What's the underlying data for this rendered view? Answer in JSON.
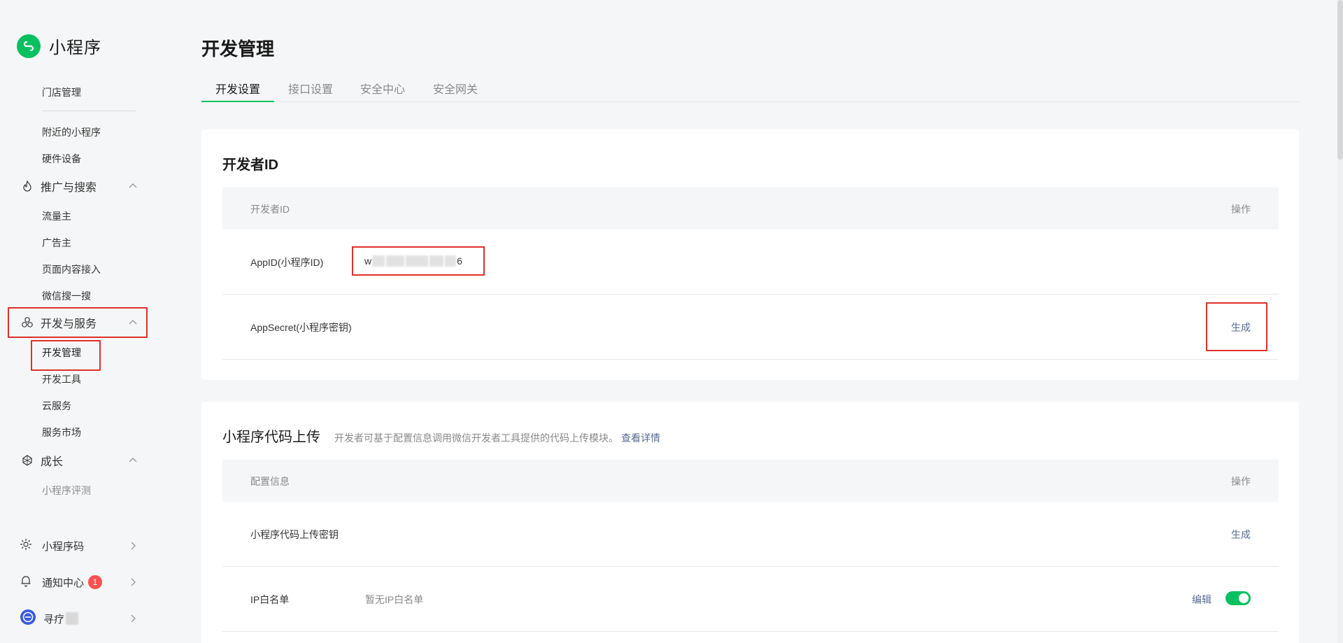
{
  "brand": {
    "title": "小程序"
  },
  "sidebar": {
    "links_top": [
      "门店管理",
      "附近的小程序",
      "硬件设备"
    ],
    "groups": {
      "promo": {
        "label": "推广与搜索",
        "children": [
          "流量主",
          "广告主",
          "页面内容接入",
          "微信搜一搜"
        ]
      },
      "dev": {
        "label": "开发与服务",
        "children": [
          "开发管理",
          "开发工具",
          "云服务",
          "服务市场"
        ]
      },
      "growth": {
        "label": "成长",
        "children": [
          "小程序评测"
        ]
      }
    },
    "bottom": {
      "qrcode": "小程序码",
      "notice": "通知中心",
      "notice_badge": "1",
      "account": "寻疗"
    }
  },
  "main": {
    "title": "开发管理",
    "tabs": [
      "开发设置",
      "接口设置",
      "安全中心",
      "安全网关"
    ],
    "devid": {
      "title": "开发者ID",
      "header": {
        "col1": "开发者ID",
        "col2": "操作"
      },
      "appid_label": "AppID(小程序ID)",
      "appid_prefix": "w",
      "appid_suffix": "6",
      "secret_label": "AppSecret(小程序密钥)",
      "secret_action": "生成"
    },
    "upload": {
      "title": "小程序代码上传",
      "desc": "开发者可基于配置信息调用微信开发者工具提供的代码上传模块。",
      "desc_link": "查看详情",
      "header": {
        "col1": "配置信息",
        "col2": "操作"
      },
      "key_label": "小程序代码上传密钥",
      "key_action": "生成",
      "ip_label": "IP白名单",
      "ip_value": "暂无IP白名单",
      "ip_action": "编辑"
    }
  },
  "colors": {
    "accent": "#07c160",
    "link": "#576b95",
    "highlight": "#e0302a",
    "badge": "#fa5151"
  }
}
